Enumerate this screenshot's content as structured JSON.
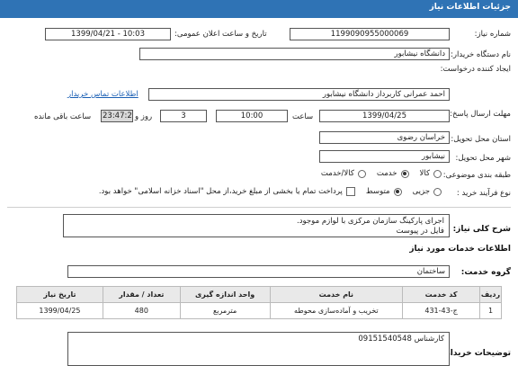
{
  "header": {
    "title": "جزئیات اطلاعات نیاز"
  },
  "fields": {
    "need_number_label": "شماره نیاز:",
    "need_number": "1199090955000069",
    "announce_label": "تاریخ و ساعت اعلان عمومی:",
    "announce_value": "1399/04/21 - 10:03",
    "buyer_label": "نام دستگاه خریدار:",
    "buyer_value": "دانشگاه نیشابور",
    "creator_label": "ایجاد کننده درخواست:",
    "creator_value": "احمد عمرانی کاربرداز دانشگاه نیشابور",
    "contact_link": "اطلاعات تماس خریدار",
    "deadline_label": "مهلت ارسال پاسخ: تا تاریخ:",
    "deadline_date": "1399/04/25",
    "time_label": "ساعت",
    "deadline_time": "10:00",
    "days_value": "3",
    "days_label": "روز و",
    "remaining_time": "23:47:28",
    "remaining_label": "ساعت باقی مانده",
    "province_label": "استان محل تحویل:",
    "province_value": "خراسان رضوی",
    "city_label": "شهر محل تحویل:",
    "city_value": "نیشابور",
    "category_label": "طبقه بندی موضوعی:",
    "category_options": [
      "کالا",
      "خدمت",
      "کالا/خدمت"
    ],
    "category_selected": "خدمت",
    "purchase_label": "نوع فرآیند خرید :",
    "purchase_options": [
      "جزیی",
      "متوسط"
    ],
    "purchase_selected": "متوسط",
    "payment_note": "پرداخت تمام یا بخشی از مبلغ خرید،از محل \"اسناد خزانه اسلامی\" خواهد بود."
  },
  "summary": {
    "label": "شرح کلی نیاز:",
    "line1": "اجرای پارکینگ سازمان مرکزی با لوازم موجود.",
    "line2": "فایل در پیوست"
  },
  "services_section": {
    "title": "اطلاعات خدمات مورد نیاز",
    "group_label": "گروه خدمت:",
    "group_value": "ساختمان",
    "columns": [
      "ردیف",
      "کد خدمت",
      "نام خدمت",
      "واحد اندازه گیری",
      "تعداد / مقدار",
      "تاریخ نیاز"
    ],
    "rows": [
      {
        "index": "1",
        "code": "ج-43-431",
        "name": "تخریب و آماده‌سازی محوطه",
        "unit": "مترمربع",
        "qty": "480",
        "date": "1399/04/25"
      }
    ]
  },
  "buyer_notes": {
    "label": "توضیحات خریدار:",
    "value": "کارشناس 09151540548"
  },
  "colors": {
    "header": "#2f73b5",
    "link": "#1a5fb4"
  }
}
